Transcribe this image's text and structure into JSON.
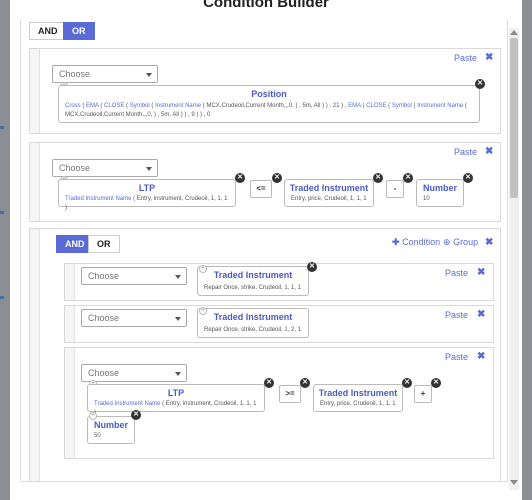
{
  "title": "Condition Builder",
  "colors": {
    "accent": "#5a6bd8",
    "overlay": "#8b8f94"
  },
  "top": {
    "and_label": "AND",
    "or_label": "OR"
  },
  "common": {
    "paste": "Paste",
    "choose": "Choose",
    "close": "✖"
  },
  "block1": {
    "title": "Position",
    "desc_parts": [
      "Cross",
      " ( ",
      "EMA",
      " ( ",
      "CLOSE",
      " ( ",
      "Symbol",
      " ( ",
      "Instrument Name",
      " ( MCX,Crudeoil,Current Month,,,0, ) , 5m, All ) ) , 21 ) , ",
      "EMA",
      " ( ",
      "CLOSE",
      " ( ",
      "Symbol",
      " ( ",
      "Instrument Name",
      " ( MCX,Crudeoil,Current Month,,,0, ) , 5m, All ) ) , 9 ) ) , 0"
    ]
  },
  "block2": {
    "left": {
      "title": "LTP",
      "desc_key": "Traded Instrument Name",
      "desc_rest": " ( Entry, instrument, Crudeoil, 1, 1, 1 )"
    },
    "op": "<=",
    "right": {
      "title": "Traded Instrument",
      "desc": "Entry, price, Crudeoil, 1, 1, 1"
    },
    "op2": "-",
    "num": {
      "title": "Number",
      "value": "10"
    }
  },
  "inner": {
    "and_label": "AND",
    "or_label": "OR",
    "condition_label": "Condition",
    "group_label": "Group",
    "rows": [
      {
        "title": "Traded Instrument",
        "desc": "Repair Once, strike, Crudeoil, 1, 1, 1"
      },
      {
        "title": "Traded Instrument",
        "desc": "Repair Once, strike, Crudeoil, 1, 2, 1"
      }
    ],
    "row3": {
      "left": {
        "title": "LTP",
        "desc_key": "Traded Instrument Name",
        "desc_rest": " ( Entry, instrument, Crudeoil, 1, 1, 1 )"
      },
      "op": ">=",
      "right": {
        "title": "Traded Instrument",
        "desc": "Entry, price, Crudeoil, 1, 1, 1"
      },
      "op2": "+",
      "num": {
        "title": "Number",
        "value": "50"
      }
    }
  }
}
